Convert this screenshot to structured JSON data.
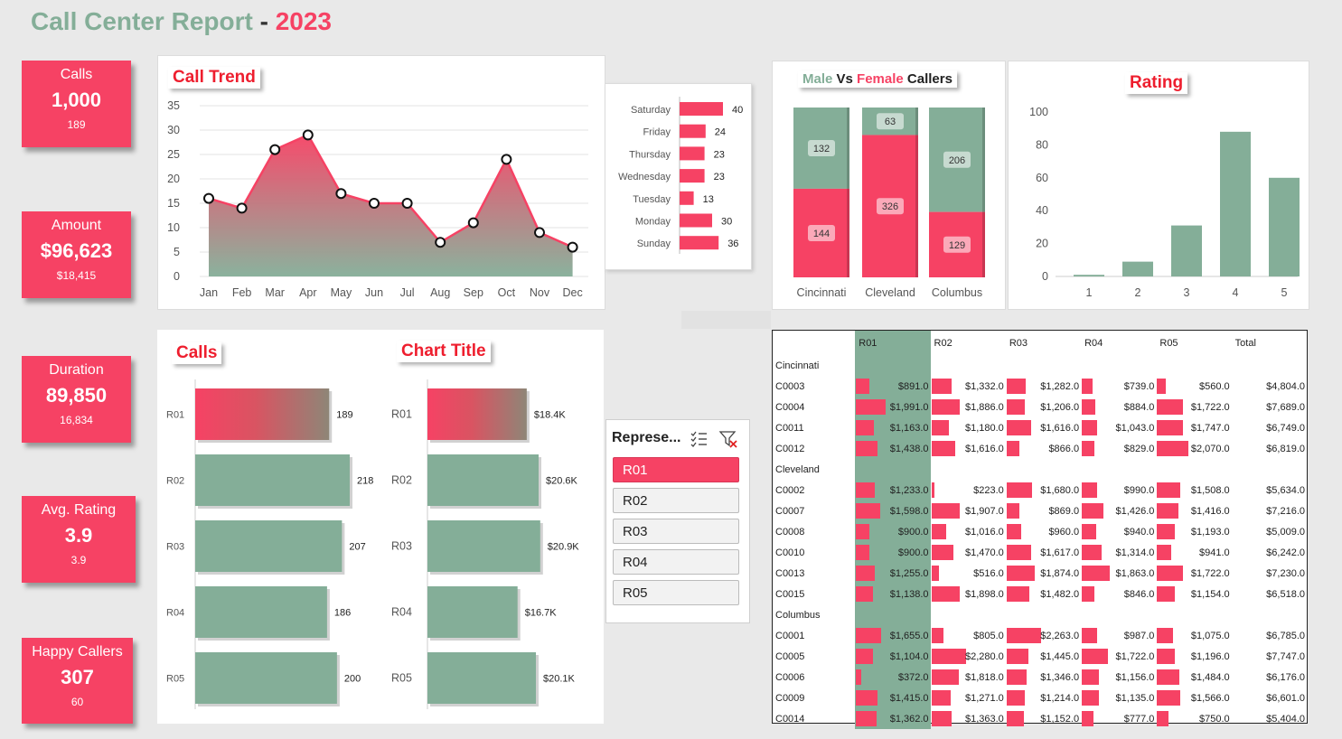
{
  "header": {
    "title_part1": "Call Center Report",
    "title_sep": " - ",
    "title_year": "2023"
  },
  "kpis": [
    {
      "label": "Calls",
      "value": "1,000",
      "sub": "189"
    },
    {
      "label": "Amount",
      "value": "$96,623",
      "sub": "$18,415"
    },
    {
      "label": "Duration",
      "value": "89,850",
      "sub": "16,834"
    },
    {
      "label": "Avg. Rating",
      "value": "3.9",
      "sub": "3.9"
    },
    {
      "label": "Happy Callers",
      "value": "307",
      "sub": "60"
    }
  ],
  "colors": {
    "pink": "#f64264",
    "green": "#84ae98",
    "title_green": "#84ae98",
    "title_red": "#f64264"
  },
  "call_trend": {
    "title": "Call Trend"
  },
  "weekday": {
    "title": ""
  },
  "gender": {
    "title_male": "Male",
    "title_vs": " Vs ",
    "title_female": "Female",
    "title_callers": " Callers"
  },
  "rating": {
    "title": "Rating"
  },
  "calls_by_rep": {
    "title": "Calls"
  },
  "amount_by_rep": {
    "title": "Chart Title"
  },
  "slicer": {
    "header": "Represe...",
    "items": [
      "R01",
      "R02",
      "R03",
      "R04",
      "R05"
    ],
    "selected": "R01"
  },
  "chart_data": [
    {
      "type": "area",
      "title": "Call Trend",
      "categories": [
        "Jan",
        "Feb",
        "Mar",
        "Apr",
        "May",
        "Jun",
        "Jul",
        "Aug",
        "Sep",
        "Oct",
        "Nov",
        "Dec"
      ],
      "values": [
        16,
        14,
        26,
        29,
        17,
        15,
        15,
        7,
        11,
        24,
        9,
        6
      ],
      "ylim": [
        0,
        35
      ],
      "yticks": [
        0,
        5,
        10,
        15,
        20,
        25,
        30,
        35
      ]
    },
    {
      "type": "bar",
      "orientation": "horizontal",
      "categories": [
        "Saturday",
        "Friday",
        "Thursday",
        "Wednesday",
        "Tuesday",
        "Monday",
        "Sunday"
      ],
      "values": [
        40,
        24,
        23,
        23,
        13,
        30,
        36
      ]
    },
    {
      "type": "bar",
      "stacked": true,
      "categories": [
        "Cincinnati",
        "Cleveland",
        "Columbus"
      ],
      "series": [
        {
          "name": "Female",
          "values": [
            144,
            326,
            129
          ]
        },
        {
          "name": "Male",
          "values": [
            132,
            63,
            206
          ]
        }
      ]
    },
    {
      "type": "bar",
      "title": "Rating",
      "categories": [
        "1",
        "2",
        "3",
        "4",
        "5"
      ],
      "values": [
        1,
        9,
        31,
        88,
        60
      ],
      "ylim": [
        0,
        100
      ],
      "yticks": [
        0,
        20,
        40,
        60,
        80,
        100
      ]
    },
    {
      "type": "bar",
      "orientation": "horizontal",
      "title": "Calls",
      "categories": [
        "R01",
        "R02",
        "R03",
        "R04",
        "R05"
      ],
      "values": [
        189,
        218,
        207,
        186,
        200
      ],
      "labels": [
        "189",
        "218",
        "207",
        "186",
        "200"
      ]
    },
    {
      "type": "bar",
      "orientation": "horizontal",
      "title": "Chart Title",
      "categories": [
        "R01",
        "R02",
        "R03",
        "R04",
        "R05"
      ],
      "values": [
        18.4,
        20.6,
        20.9,
        16.7,
        20.1
      ],
      "labels": [
        "$18.4K",
        "$20.6K",
        "$20.9K",
        "$16.7K",
        "$20.1K"
      ]
    },
    {
      "type": "table",
      "columns": [
        "R01",
        "R02",
        "R03",
        "R04",
        "R05",
        "Total"
      ],
      "groups": [
        {
          "name": "Cincinnati",
          "rows": [
            {
              "id": "C0003",
              "values": [
                "$891.0",
                "$1,332.0",
                "$1,282.0",
                "$739.0",
                "$560.0"
              ],
              "nums": [
                891,
                1332,
                1282,
                739,
                560
              ],
              "total": "$4,804.0"
            },
            {
              "id": "C0004",
              "values": [
                "$1,991.0",
                "$1,886.0",
                "$1,206.0",
                "$884.0",
                "$1,722.0"
              ],
              "nums": [
                1991,
                1886,
                1206,
                884,
                1722
              ],
              "total": "$7,689.0"
            },
            {
              "id": "C0011",
              "values": [
                "$1,163.0",
                "$1,180.0",
                "$1,616.0",
                "$1,043.0",
                "$1,747.0"
              ],
              "nums": [
                1163,
                1180,
                1616,
                1043,
                1747
              ],
              "total": "$6,749.0"
            },
            {
              "id": "C0012",
              "values": [
                "$1,438.0",
                "$1,616.0",
                "$866.0",
                "$829.0",
                "$2,070.0"
              ],
              "nums": [
                1438,
                1616,
                866,
                829,
                2070
              ],
              "total": "$6,819.0"
            }
          ]
        },
        {
          "name": "Cleveland",
          "rows": [
            {
              "id": "C0002",
              "values": [
                "$1,233.0",
                "$223.0",
                "$1,680.0",
                "$990.0",
                "$1,508.0"
              ],
              "nums": [
                1233,
                223,
                1680,
                990,
                1508
              ],
              "total": "$5,634.0"
            },
            {
              "id": "C0007",
              "values": [
                "$1,598.0",
                "$1,907.0",
                "$869.0",
                "$1,426.0",
                "$1,416.0"
              ],
              "nums": [
                1598,
                1907,
                869,
                1426,
                1416
              ],
              "total": "$7,216.0"
            },
            {
              "id": "C0008",
              "values": [
                "$900.0",
                "$1,016.0",
                "$960.0",
                "$940.0",
                "$1,193.0"
              ],
              "nums": [
                900,
                1016,
                960,
                940,
                1193
              ],
              "total": "$5,009.0"
            },
            {
              "id": "C0010",
              "values": [
                "$900.0",
                "$1,470.0",
                "$1,617.0",
                "$1,314.0",
                "$941.0"
              ],
              "nums": [
                900,
                1470,
                1617,
                1314,
                941
              ],
              "total": "$6,242.0"
            },
            {
              "id": "C0013",
              "values": [
                "$1,255.0",
                "$516.0",
                "$1,874.0",
                "$1,863.0",
                "$1,722.0"
              ],
              "nums": [
                1255,
                516,
                1874,
                1863,
                1722
              ],
              "total": "$7,230.0"
            },
            {
              "id": "C0015",
              "values": [
                "$1,138.0",
                "$1,898.0",
                "$1,482.0",
                "$846.0",
                "$1,154.0"
              ],
              "nums": [
                1138,
                1898,
                1482,
                846,
                1154
              ],
              "total": "$6,518.0"
            }
          ]
        },
        {
          "name": "Columbus",
          "rows": [
            {
              "id": "C0001",
              "values": [
                "$1,655.0",
                "$805.0",
                "$2,263.0",
                "$987.0",
                "$1,075.0"
              ],
              "nums": [
                1655,
                805,
                2263,
                987,
                1075
              ],
              "total": "$6,785.0"
            },
            {
              "id": "C0005",
              "values": [
                "$1,104.0",
                "$2,280.0",
                "$1,445.0",
                "$1,722.0",
                "$1,196.0"
              ],
              "nums": [
                1104,
                2280,
                1445,
                1722,
                1196
              ],
              "total": "$7,747.0"
            },
            {
              "id": "C0006",
              "values": [
                "$372.0",
                "$1,818.0",
                "$1,346.0",
                "$1,156.0",
                "$1,484.0"
              ],
              "nums": [
                372,
                1818,
                1346,
                1156,
                1484
              ],
              "total": "$6,176.0"
            },
            {
              "id": "C0009",
              "values": [
                "$1,415.0",
                "$1,271.0",
                "$1,214.0",
                "$1,135.0",
                "$1,566.0"
              ],
              "nums": [
                1415,
                1271,
                1214,
                1135,
                1566
              ],
              "total": "$6,601.0"
            },
            {
              "id": "C0014",
              "values": [
                "$1,362.0",
                "$1,363.0",
                "$1,152.0",
                "$777.0",
                "$750.0"
              ],
              "nums": [
                1362,
                1363,
                1152,
                777,
                750
              ],
              "total": "$5,404.0"
            }
          ]
        }
      ]
    }
  ]
}
